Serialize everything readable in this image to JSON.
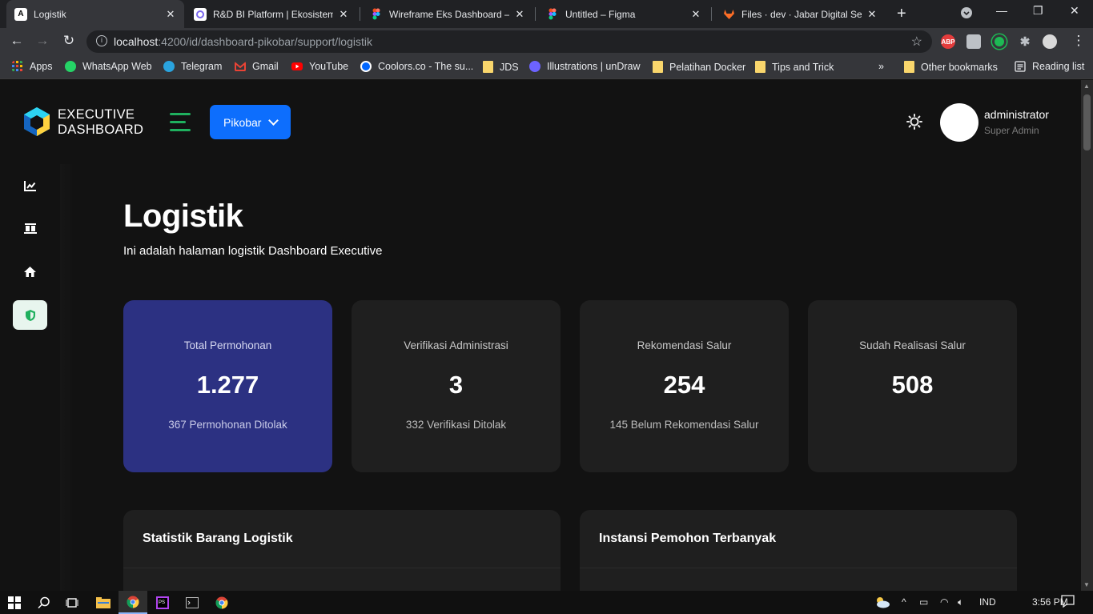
{
  "browser": {
    "tabs": [
      {
        "title": "Logistik",
        "favicon": "angular-icon",
        "active": true
      },
      {
        "title": "R&D BI Platform | Ekosistem Data Jabar",
        "favicon": "clickup-icon",
        "active": false
      },
      {
        "title": "Wireframe Eks Dashboard – Figma",
        "favicon": "figma-icon",
        "active": false
      },
      {
        "title": "Untitled – Figma",
        "favicon": "figma-icon",
        "active": false
      },
      {
        "title": "Files · dev · Jabar Digital Service",
        "favicon": "gitlab-icon",
        "active": false
      }
    ],
    "url": {
      "host": "localhost",
      "rest": ":4200/id/dashboard-pikobar/support/logistik"
    },
    "bookmarks": [
      {
        "label": "Apps",
        "icon": "apps-grid-icon"
      },
      {
        "label": "WhatsApp Web",
        "icon": "whatsapp-icon"
      },
      {
        "label": "Telegram",
        "icon": "telegram-icon"
      },
      {
        "label": "Gmail",
        "icon": "gmail-icon"
      },
      {
        "label": "YouTube",
        "icon": "youtube-icon"
      },
      {
        "label": "Coolors.co - The su...",
        "icon": "coolors-icon"
      },
      {
        "label": "JDS",
        "icon": "folder-icon"
      },
      {
        "label": "Illustrations | unDraw",
        "icon": "undraw-icon"
      },
      {
        "label": "Pelatihan Docker",
        "icon": "folder-icon"
      },
      {
        "label": "Tips and Trick",
        "icon": "folder-icon"
      }
    ],
    "bookmarks_more": "»",
    "other_bookmarks": "Other bookmarks",
    "reading_list": "Reading list",
    "extensions": {
      "abp_label": "ABP"
    }
  },
  "app": {
    "brand": {
      "line1": "EXECUTIVE",
      "line2": "DASHBOARD"
    },
    "dropdown_label": "Pikobar",
    "user": {
      "name": "administrator",
      "role": "Super Admin"
    },
    "sidebar": [
      {
        "icon": "chart-line-icon",
        "active": false
      },
      {
        "icon": "hospital-beds-icon",
        "active": false
      },
      {
        "icon": "home-icon",
        "active": false
      },
      {
        "icon": "shield-icon",
        "active": true
      }
    ],
    "page": {
      "title": "Logistik",
      "subtitle": "Ini adalah halaman logistik Dashboard Executive"
    },
    "cards": [
      {
        "label": "Total Permohonan",
        "value": "1.277",
        "note": "367 Permohonan Ditolak"
      },
      {
        "label": "Verifikasi Administrasi",
        "value": "3",
        "note": "332 Verifikasi Ditolak"
      },
      {
        "label": "Rekomendasi Salur",
        "value": "254",
        "note": "145 Belum Rekomendasi Salur"
      },
      {
        "label": "Sudah Realisasi Salur",
        "value": "508",
        "note": ""
      }
    ],
    "panels": [
      {
        "title": "Statistik Barang Logistik"
      },
      {
        "title": "Instansi Pemohon Terbanyak"
      }
    ],
    "colors": {
      "accent": "#0d6efd",
      "highlight_card": "#2c3182",
      "menu_green": "#1fb05e"
    }
  },
  "taskbar": {
    "language": "IND",
    "time": "3:56 PM"
  }
}
